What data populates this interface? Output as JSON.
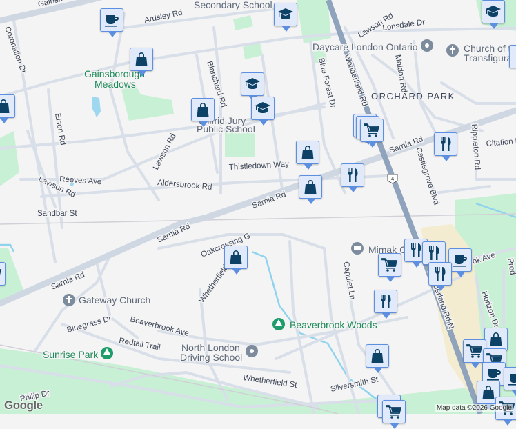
{
  "map": {
    "labels": {
      "gainsborough_rd": "Gainsb",
      "secondary_school": "Secondary School",
      "ardsley_rd": "Ardsley Rd",
      "coronation_dr": "Coronation Dr",
      "gainsborough_meadows_1": "Gainsborough",
      "gainsborough_meadows_2": "Meadows",
      "blanchard_rd": "Blanchard Rd",
      "elson_rd": "Elson Rd",
      "wilfrid_jury_1": "Wilfrid Jury",
      "wilfrid_jury_2": "Public School",
      "lawson_rd_mid": "Lawson Rd",
      "lawson_rd_west": "Lawson Rd",
      "lawson_rd_ne": "Lawson Rd",
      "reeves_ave": "Reeves Ave",
      "aldersbrook_rd": "Aldersbrook Rd",
      "thistledown_way": "Thistledown Way",
      "sandbar_st": "Sandbar St",
      "sarnia_rd_1": "Sarnia Rd",
      "sarnia_rd_2": "Sarnia Rd",
      "sarnia_rd_3": "Sarnia Rd",
      "sarnia_rd_4": "Sarnia Rd",
      "lonsdale_dr": "Lonsdale Dr",
      "daycare": "Daycare London Ontario",
      "church_transfig_1": "Church of the",
      "church_transfig_2": "Transfiguration",
      "blue_forest_dr": "Blue Forest Dr",
      "wonderland_rd": "Wonderland Rd",
      "wonderland_rd_n": "Wonderland Rd N",
      "maldon_rd": "Maldon Rd",
      "orchard_park": "ORCHARD PARK",
      "castlegrove_blvd": "Castlegrove Blvd",
      "rippleton_rd": "Rippleton Rd",
      "citation_dr": "Citation Dr",
      "highway_4": "4",
      "oakcrossing": "Oakcrossing G",
      "mimak": "Mimak C",
      "capulet_ln": "Capulet Ln",
      "beaverbrook_ave_e": "ok Ave",
      "gateway_church": "Gateway Church",
      "whetherfield_n": "Whetherfield",
      "bluegrass_dr": "Bluegrass Dr",
      "beaverbrook_ave": "Beaverbrook Ave",
      "beaverbrook_woods": "Beaverbrook Woods",
      "redtail_trail": "Redtail Trail",
      "horizon_dr": "Horizon Dr",
      "sunrise_park": "Sunrise Park",
      "north_london_1": "North London",
      "north_london_2": "Driving School",
      "whetherfield_st": "Whetherfield St",
      "silversmith_st": "Silversmith St",
      "philip_dr": "Philip Dr",
      "prod": "Prod"
    },
    "attribution": "Map data ©2026 Google",
    "logo": "Google",
    "markers": [
      {
        "type": "cafe",
        "icon": "coffee-cup-icon"
      },
      {
        "type": "shopping",
        "icon": "shopping-bag-icon"
      },
      {
        "type": "school",
        "icon": "graduation-cap-icon"
      },
      {
        "type": "grocery",
        "icon": "shopping-cart-icon"
      },
      {
        "type": "restaurant",
        "icon": "fork-knife-icon"
      }
    ],
    "colors": {
      "marker_bg": "#e1eafb",
      "marker_border": "#5d8fe0",
      "icon": "#0d4266",
      "park": "#c8f0d5",
      "highway": "#8fa3bd"
    }
  }
}
